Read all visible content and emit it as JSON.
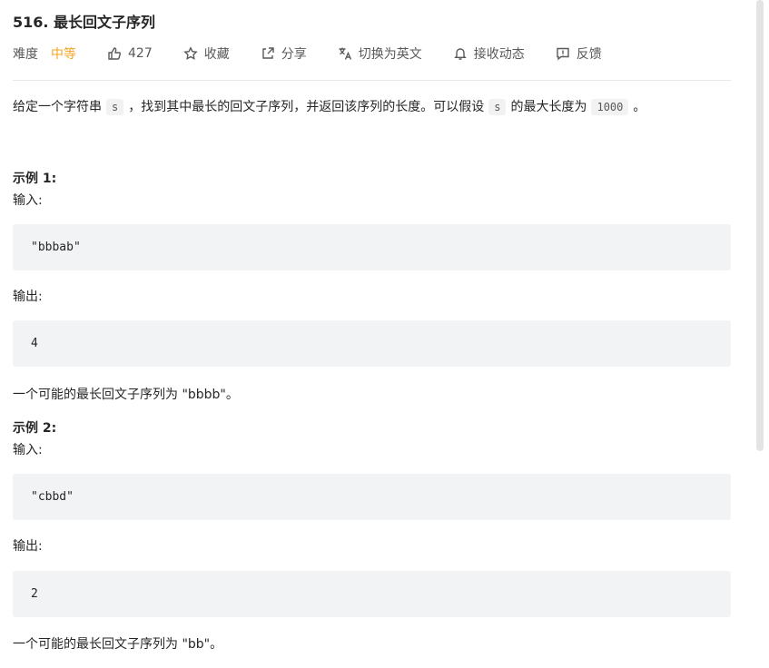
{
  "problem": {
    "title": "516. 最长回文子序列",
    "difficulty_label": "难度",
    "difficulty_value": "中等",
    "likes": "427",
    "favorite_label": "收藏",
    "share_label": "分享",
    "switch_lang_label": "切换为英文",
    "notify_label": "接收动态",
    "feedback_label": "反馈"
  },
  "description": {
    "part1": "给定一个字符串",
    "code_s": "s",
    "part2": "，找到其中最长的回文子序列，并返回该序列的长度。可以假设",
    "code_s2": "s",
    "part3": "的最大长度为",
    "code_1000": "1000",
    "part4": "。"
  },
  "examples": [
    {
      "title": "示例 1:",
      "input_label": "输入:",
      "input": "\"bbbab\"",
      "output_label": "输出:",
      "output": "4",
      "explanation": "一个可能的最长回文子序列为 \"bbbb\"。"
    },
    {
      "title": "示例 2:",
      "input_label": "输入:",
      "input": "\"cbbd\"",
      "output_label": "输出:",
      "output": "2",
      "explanation": "一个可能的最长回文子序列为 \"bb\"。"
    }
  ],
  "colors": {
    "difficulty_medium": "#f5a524",
    "code_bg": "#f2f3f4",
    "text": "#262626"
  }
}
